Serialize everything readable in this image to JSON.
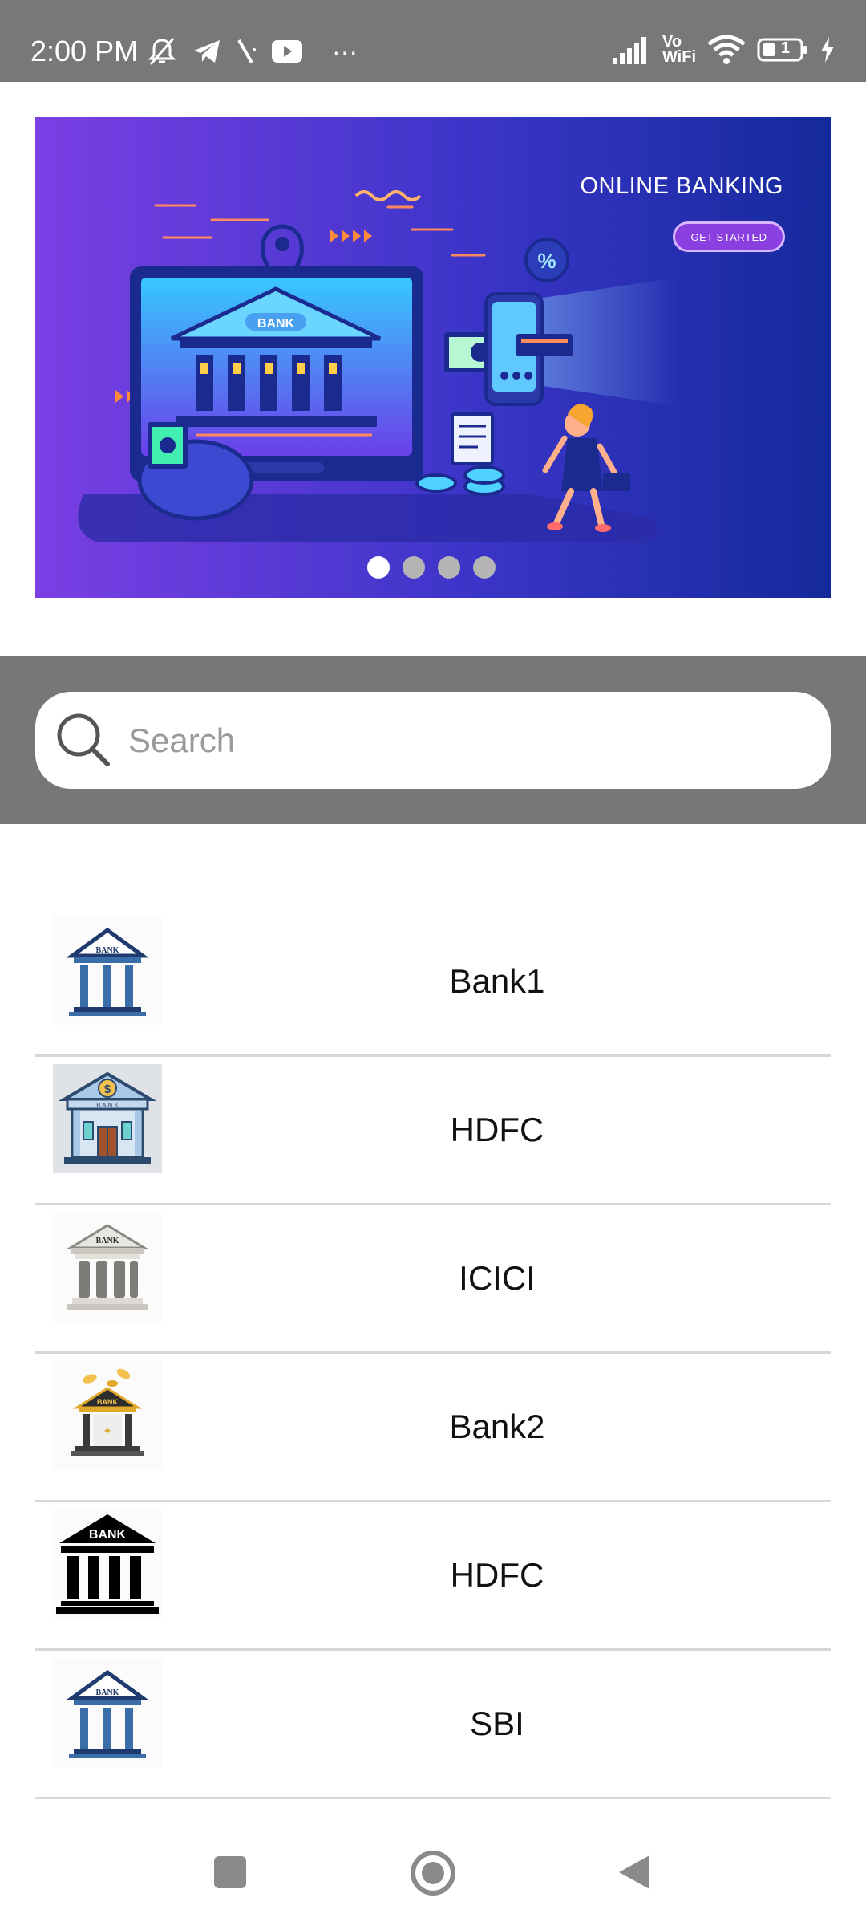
{
  "status_bar": {
    "time": "2:00 PM",
    "network_label_top": "Vo",
    "network_label_bottom": "WiFi",
    "battery_level": "1",
    "overflow_indicator": "···"
  },
  "banner": {
    "title": "ONLINE BANKING",
    "cta_label": "GET STARTED",
    "building_sign": "BANK",
    "percent_badge": "%",
    "slide_count": 4,
    "active_slide": 1,
    "colors": {
      "gradient_start": "#7b3fe4",
      "gradient_end": "#142a9c"
    }
  },
  "search": {
    "placeholder": "Search",
    "value": ""
  },
  "banks": [
    {
      "name": "Bank1",
      "icon": "bank-classic-blue-icon"
    },
    {
      "name": "HDFC",
      "icon": "bank-dollar-building-icon"
    },
    {
      "name": "ICICI",
      "icon": "bank-gray-pillars-icon"
    },
    {
      "name": "Bank2",
      "icon": "bank-gold-coins-icon"
    },
    {
      "name": "HDFC",
      "icon": "bank-black-icon"
    },
    {
      "name": "SBI",
      "icon": "bank-classic-blue-icon"
    }
  ],
  "icon_text": {
    "bank": "BANK",
    "bank_spaced": "B A N K",
    "dollar": "$"
  },
  "nav": {
    "recents": "square-icon",
    "home": "circle-icon",
    "back": "triangle-back-icon"
  }
}
